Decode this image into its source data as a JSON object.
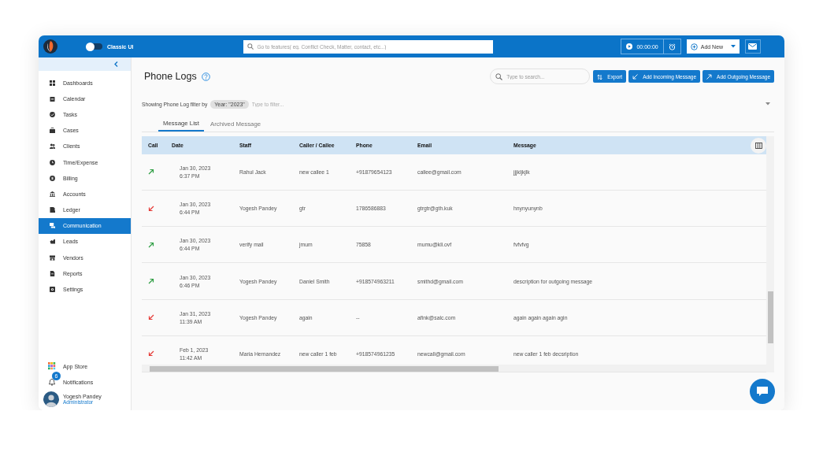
{
  "topbar": {
    "classic_ui": {
      "label": "Classic UI",
      "on": false
    },
    "search": {
      "placeholder": "Go to features( eg. Conflict Check, Matter, contact, etc...)"
    },
    "timer": "00:00:00",
    "add_new": "Add New"
  },
  "sidebar": {
    "items": [
      {
        "label": "Dashboards",
        "selected": false
      },
      {
        "label": "Calendar",
        "selected": false
      },
      {
        "label": "Tasks",
        "selected": false
      },
      {
        "label": "Cases",
        "selected": false
      },
      {
        "label": "Clients",
        "selected": false
      },
      {
        "label": "Time/Expense",
        "selected": false
      },
      {
        "label": "Billing",
        "selected": false
      },
      {
        "label": "Accounts",
        "selected": false
      },
      {
        "label": "Ledger",
        "selected": false
      },
      {
        "label": "Communication",
        "selected": true
      },
      {
        "label": "Leads",
        "selected": false
      },
      {
        "label": "Vendors",
        "selected": false
      },
      {
        "label": "Reports",
        "selected": false
      },
      {
        "label": "Settings",
        "selected": false
      }
    ],
    "app_store": "App Store",
    "notifications": {
      "label": "Notifications",
      "badge": "6"
    },
    "user": {
      "name": "Yogesh Pandey",
      "role": "Administrator"
    }
  },
  "page": {
    "title": "Phone Logs",
    "search": {
      "placeholder": "Type to search..."
    },
    "buttons": [
      {
        "kind": "export",
        "label": "Export"
      },
      {
        "kind": "incoming",
        "label": "Add Incoming Message"
      },
      {
        "kind": "outgoing",
        "label": "Add Outgoing Message"
      }
    ],
    "filter": {
      "label": "Showing Phone Log filter by",
      "chips": [
        "Year: \"2023\""
      ],
      "placeholder": "Type to filter..."
    },
    "tabs": [
      {
        "label": "Message List",
        "selected": true
      },
      {
        "label": "Archived Message",
        "selected": false
      }
    ],
    "table": {
      "columns": [
        "Call",
        "Date",
        "Staff",
        "Caller / Callee",
        "Phone",
        "Email",
        "Message"
      ],
      "rows": [
        {
          "kind": "outgoing",
          "date": "Jan 30, 2023",
          "time": "6:37 PM",
          "staff": "Rahul Jack",
          "caller": "new callee 1",
          "phone": "+91879654123",
          "email": "callee@gmail.com",
          "message": "jjjkljkjlk"
        },
        {
          "kind": "incoming",
          "date": "Jan 30, 2023",
          "time": "6:44 PM",
          "staff": "Yogesh Pandey",
          "caller": "gtr",
          "phone": "1786586883",
          "email": "gtrgtr@gth.kuk",
          "message": "hnynyunynb"
        },
        {
          "kind": "outgoing",
          "date": "Jan 30, 2023",
          "time": "6:44 PM",
          "staff": "verify mail",
          "caller": "jmum",
          "phone": "75858",
          "email": "mumu@kli.ovf",
          "message": "fvfvfvg"
        },
        {
          "kind": "outgoing",
          "date": "Jan 30, 2023",
          "time": "6:46 PM",
          "staff": "Yogesh Pandey",
          "caller": "Daniel Smith",
          "phone": "+918574963211",
          "email": "smithd@gmail.com",
          "message": "description for outgoing message"
        },
        {
          "kind": "incoming",
          "date": "Jan 31, 2023",
          "time": "11:39 AM",
          "staff": "Yogesh Pandey",
          "caller": "again",
          "phone": "--",
          "email": "afink@salc.com",
          "message": "again again again agin"
        },
        {
          "kind": "incoming",
          "date": "Feb 1, 2023",
          "time": "11:42 AM",
          "staff": "Maria Hernandez",
          "caller": "new caller 1 feb",
          "phone": "+918574961235",
          "email": "newcall@gmail.com",
          "message": "new caller 1 feb decsription"
        }
      ]
    }
  }
}
